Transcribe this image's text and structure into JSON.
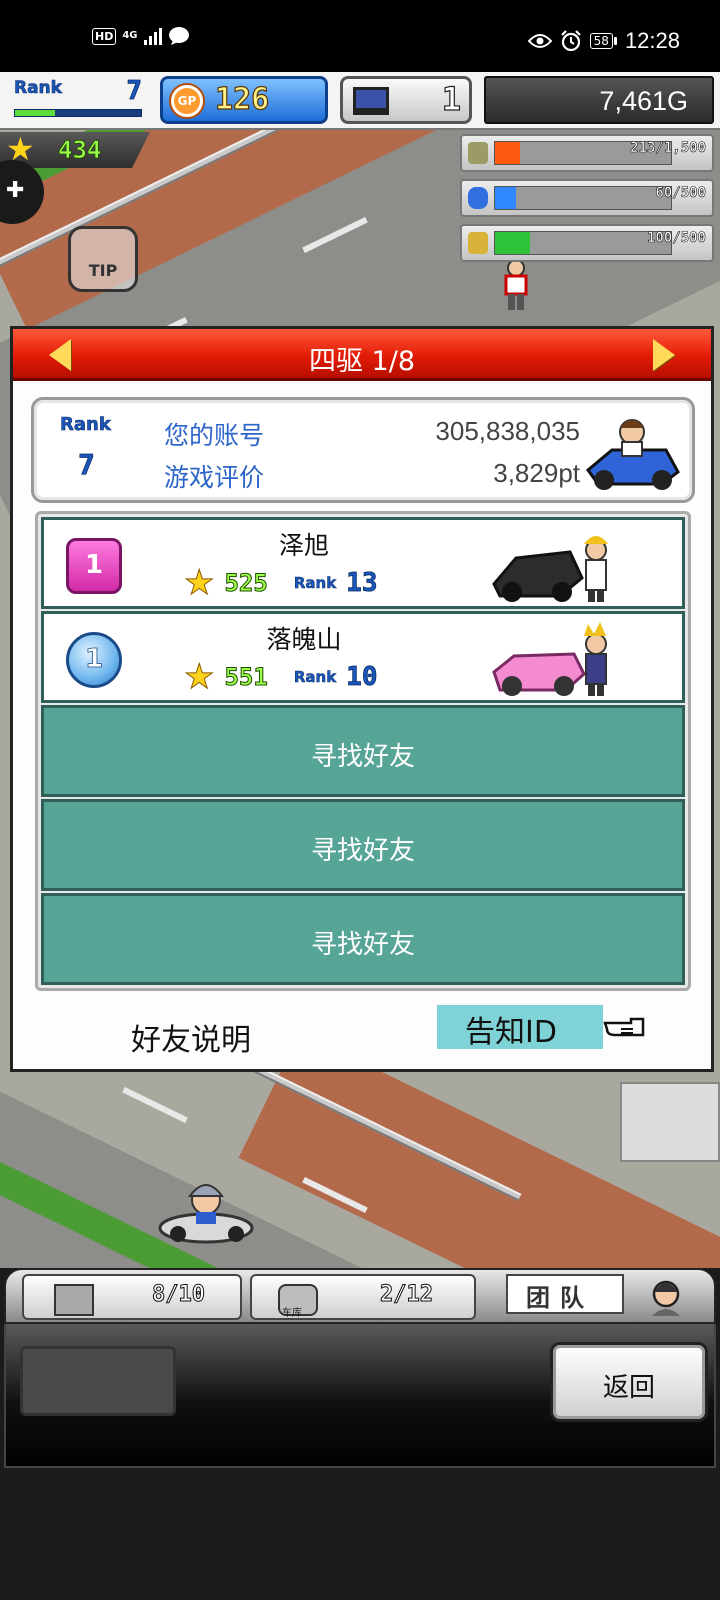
{
  "status_bar": {
    "hd": "HD",
    "network": "4G",
    "battery": "58",
    "time": "12:28"
  },
  "hud": {
    "rank_label": "Rank",
    "rank_value": "7",
    "rank_progress": 0.32,
    "gp_icon_text": "GP",
    "gp_value": "126",
    "pc_value": "1",
    "money": "7,461G",
    "stars": "434"
  },
  "resources": [
    {
      "name": "materials",
      "text": "213/1,500",
      "fraction": 0.142,
      "color": "#ff5a12"
    },
    {
      "name": "fuel",
      "text": "60/500",
      "fraction": 0.12,
      "color": "#2f88ff"
    },
    {
      "name": "crops",
      "text": "100/500",
      "fraction": 0.2,
      "color": "#2cc23a"
    }
  ],
  "scene": {
    "tip_label": "TIP"
  },
  "dialog": {
    "title": "四驱 1/8",
    "account": {
      "rank_label": "Rank",
      "rank_value": "7",
      "id_label": "您的账号",
      "id_value": "305,838,035",
      "rating_label": "游戏评价",
      "rating_value": "3,829pt"
    },
    "friends": [
      {
        "medal": "1",
        "name": "泽旭",
        "stars": "525",
        "rank_label": "Rank",
        "rank": "13"
      },
      {
        "medal": "1",
        "name": "落魄山",
        "stars": "551",
        "rank_label": "Rank",
        "rank": "10"
      }
    ],
    "empty_slot_label": "寻找好友",
    "footer": {
      "friend_help": "好友说明",
      "notify_id": "告知ID"
    }
  },
  "bottom": {
    "tab1_count": "8/10",
    "tab2_label": "车库",
    "tab2_count": "2/12",
    "team_label": "团队",
    "back": "返回"
  }
}
